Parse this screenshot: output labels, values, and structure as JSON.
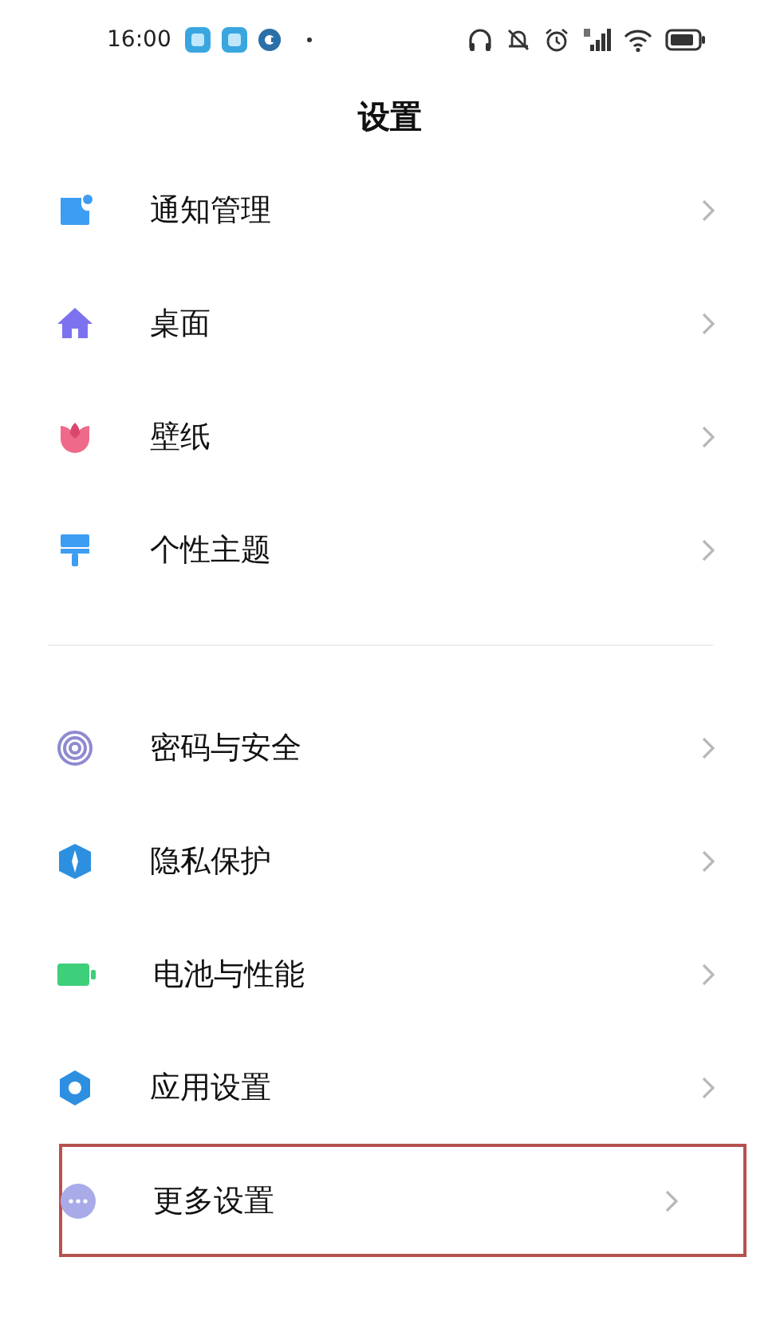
{
  "status_bar": {
    "time": "16:00"
  },
  "title": "设置",
  "groups": [
    {
      "items": [
        {
          "kind": "notification",
          "label": "通知管理",
          "highlighted": false
        },
        {
          "kind": "home",
          "label": "桌面",
          "highlighted": false
        },
        {
          "kind": "wallpaper",
          "label": "壁纸",
          "highlighted": false
        },
        {
          "kind": "theme",
          "label": "个性主题",
          "highlighted": false
        }
      ]
    },
    {
      "items": [
        {
          "kind": "password",
          "label": "密码与安全",
          "highlighted": false
        },
        {
          "kind": "privacy",
          "label": "隐私保护",
          "highlighted": false
        },
        {
          "kind": "battery",
          "label": "电池与性能",
          "highlighted": false
        },
        {
          "kind": "apps",
          "label": "应用设置",
          "highlighted": false
        },
        {
          "kind": "more",
          "label": "更多设置",
          "highlighted": true
        }
      ]
    }
  ]
}
